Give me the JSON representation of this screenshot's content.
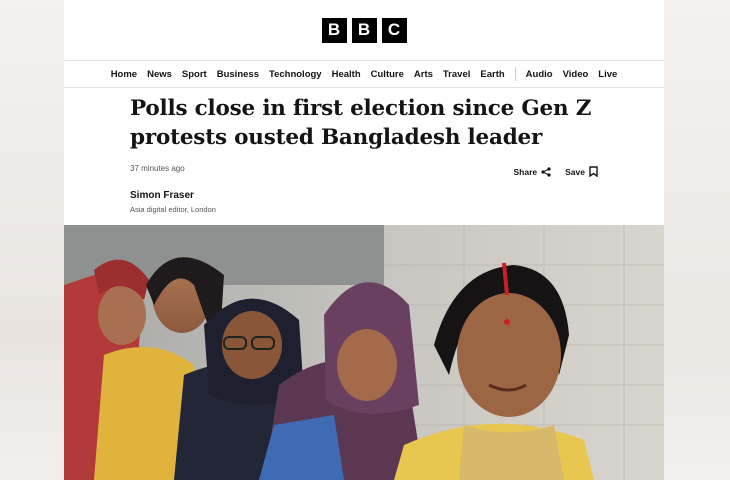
{
  "brand": {
    "letters": [
      "B",
      "B",
      "C"
    ]
  },
  "nav": {
    "items": [
      "Home",
      "News",
      "Sport",
      "Business",
      "Technology",
      "Health",
      "Culture",
      "Arts",
      "Travel",
      "Earth"
    ],
    "media_items": [
      "Audio",
      "Video",
      "Live"
    ]
  },
  "article": {
    "headline_line1": "Polls close in first election since Gen Z",
    "headline_line2": "protests ousted Bangladesh leader",
    "timestamp": "37 minutes ago",
    "share_label": "Share",
    "save_label": "Save",
    "author": "Simon Fraser",
    "author_role": "Asia digital editor, London"
  },
  "hero_image": {
    "icon": "photo",
    "subject": "women voters queueing"
  }
}
